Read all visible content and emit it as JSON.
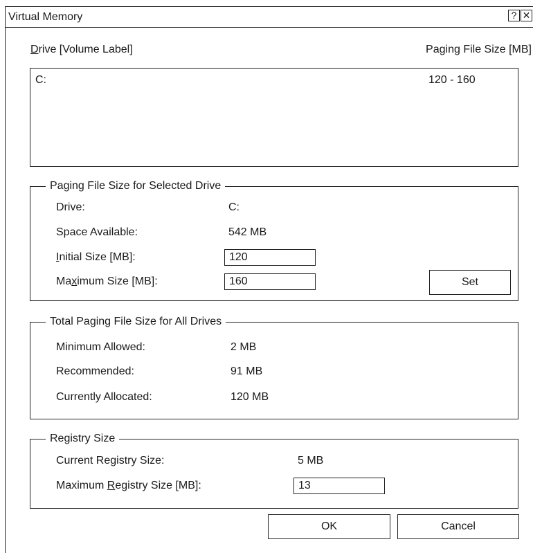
{
  "window": {
    "title": "Virtual Memory",
    "help_glyph": "?",
    "close_glyph": "✕"
  },
  "list": {
    "header_drive_mnemonic": "D",
    "header_drive_rest": "rive [Volume Label]",
    "header_size": "Paging File Size [MB]",
    "rows": [
      {
        "drive": "C:",
        "size": "120 - 160"
      }
    ]
  },
  "selected_drive": {
    "legend": "Paging File Size for Selected Drive",
    "drive_label": "Drive:",
    "drive_value": "C:",
    "space_label": "Space Available:",
    "space_value": "542 MB",
    "initial_label_mnemonic": "I",
    "initial_label_rest": "nitial Size [MB]:",
    "initial_value": "120",
    "max_label_pre": "Ma",
    "max_label_mnemonic": "x",
    "max_label_rest": "imum Size [MB]:",
    "max_value": "160",
    "set_label": "Set"
  },
  "total": {
    "legend": "Total Paging File Size for All Drives",
    "min_label": "Minimum Allowed:",
    "min_value": "2 MB",
    "rec_label": "Recommended:",
    "rec_value": "91 MB",
    "alloc_label": "Currently Allocated:",
    "alloc_value": "120 MB"
  },
  "registry": {
    "legend": "Registry Size",
    "current_label": "Current Registry Size:",
    "current_value": "5 MB",
    "max_label_pre": "Maximum ",
    "max_label_mnemonic": "R",
    "max_label_rest": "egistry Size [MB]:",
    "max_value": "13"
  },
  "footer": {
    "ok_label": "OK",
    "cancel_label": "Cancel"
  }
}
